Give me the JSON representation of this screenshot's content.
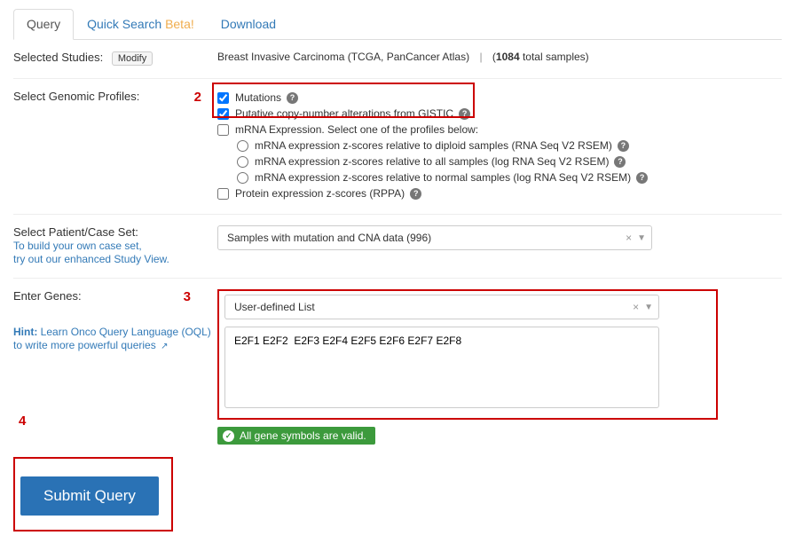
{
  "tabs": {
    "query": "Query",
    "quick_search": "Quick Search",
    "quick_search_beta": "Beta!",
    "download": "Download"
  },
  "selected_studies": {
    "label": "Selected Studies:",
    "modify_label": "Modify",
    "study_name": "Breast Invasive Carcinoma (TCGA, PanCancer Atlas)",
    "sample_count": "1084",
    "sample_text": " total samples"
  },
  "genomic_profiles": {
    "label": "Select Genomic Profiles:",
    "mutations": "Mutations",
    "cna": "Putative copy-number alterations from GISTIC",
    "mrna_header": "mRNA Expression. Select one of the profiles below:",
    "mrna_diploid": "mRNA expression z-scores relative to diploid samples (RNA Seq V2 RSEM)",
    "mrna_all": "mRNA expression z-scores relative to all samples (log RNA Seq V2 RSEM)",
    "mrna_normal": "mRNA expression z-scores relative to normal samples (log RNA Seq V2 RSEM)",
    "protein": "Protein expression z-scores (RPPA)"
  },
  "case_set": {
    "label": "Select Patient/Case Set:",
    "hint1": "To build your own case set,",
    "hint2": "try out our enhanced Study View.",
    "value": "Samples with mutation and CNA data (996)"
  },
  "genes": {
    "label": "Enter Genes:",
    "hint_prefix": "Hint:",
    "hint_link": " Learn Onco Query Language (OQL)",
    "hint_suffix": "to write more powerful queries",
    "list_type": "User-defined List",
    "textarea_value": "E2F1 E2F2  E2F3 E2F4 E2F5 E2F6 E2F7 E2F8",
    "validation": "All gene symbols are valid."
  },
  "annotations": {
    "two": "2",
    "three": "3",
    "four": "4"
  },
  "submit": {
    "label": "Submit Query"
  }
}
